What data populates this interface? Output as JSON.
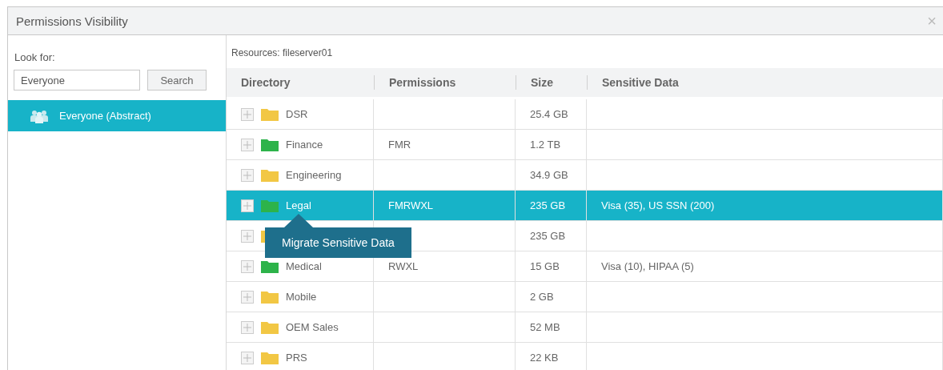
{
  "window": {
    "title": "Permissions Visibility",
    "close": "×"
  },
  "left_panel": {
    "look_for_label": "Look for:",
    "search_field": {
      "value": "Everyone"
    },
    "search_button": "Search",
    "results": [
      {
        "label": "Everyone (Abstract)",
        "selected": true
      }
    ]
  },
  "resources_label": "Resources: fileserver01",
  "table": {
    "columns": [
      "Directory",
      "Permissions",
      "Size",
      "Sensitive Data"
    ],
    "rows": [
      {
        "name": "DSR",
        "permissions": "",
        "size": "25.4 GB",
        "sensitive": "",
        "color": "#f2c744",
        "selected": false
      },
      {
        "name": "Finance",
        "permissions": "FMR",
        "size": "1.2 TB",
        "sensitive": "",
        "color": "#2db34a",
        "selected": false
      },
      {
        "name": "Engineering",
        "permissions": "",
        "size": "34.9 GB",
        "sensitive": "",
        "color": "#f2c744",
        "selected": false
      },
      {
        "name": "Legal",
        "permissions": "FMRWXL",
        "size": "235 GB",
        "sensitive": "Visa (35), US SSN (200)",
        "color": "#2db34a",
        "selected": true
      },
      {
        "permissions": "",
        "size": "235 GB",
        "sensitive": "",
        "color": "#f2c744",
        "selected": false
      },
      {
        "name": "Medical",
        "permissions": "RWXL",
        "size": "15 GB",
        "sensitive": "Visa (10), HIPAA (5)",
        "color": "#2db34a",
        "selected": false
      },
      {
        "name": "Mobile",
        "permissions": "",
        "size": "2 GB",
        "sensitive": "",
        "color": "#f2c744",
        "selected": false
      },
      {
        "name": "OEM Sales",
        "permissions": "",
        "size": "52 MB",
        "sensitive": "",
        "color": "#f2c744",
        "selected": false
      },
      {
        "name": "PRS",
        "permissions": "",
        "size": "22 KB",
        "sensitive": "",
        "color": "#f2c744",
        "selected": false
      }
    ]
  },
  "tooltip": {
    "text": "Migrate Sensitive Data"
  }
}
